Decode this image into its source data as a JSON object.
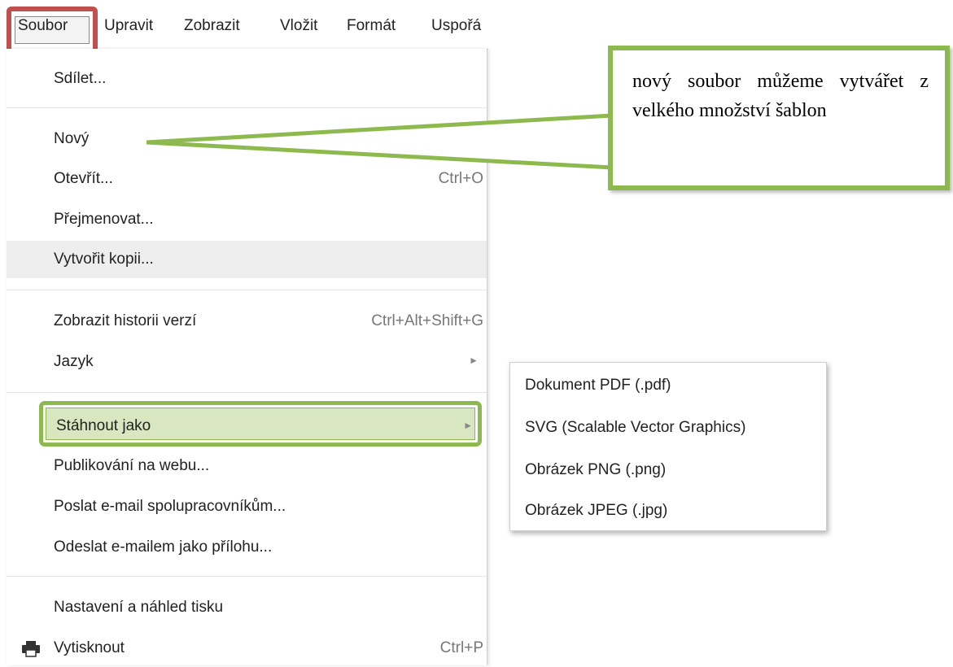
{
  "menubar": {
    "items": [
      "Soubor",
      "Upravit",
      "Zobrazit",
      "Vložit",
      "Formát",
      "Uspořá"
    ]
  },
  "menu": {
    "items": [
      {
        "label": "Sdílet...",
        "shortcut": ""
      },
      {
        "label": "Nový",
        "shortcut": ""
      },
      {
        "label": "Otevřít...",
        "shortcut": "Ctrl+O"
      },
      {
        "label": "Přejmenovat...",
        "shortcut": ""
      },
      {
        "label": "Vytvořit kopii...",
        "shortcut": ""
      },
      {
        "label": "Zobrazit historii verzí",
        "shortcut": "Ctrl+Alt+Shift+G"
      },
      {
        "label": "Jazyk",
        "shortcut": ""
      },
      {
        "label": "Stáhnout jako",
        "shortcut": ""
      },
      {
        "label": "Publikování na webu...",
        "shortcut": ""
      },
      {
        "label": "Poslat e-mail spolupracovníkům...",
        "shortcut": ""
      },
      {
        "label": "Odeslat e-mailem jako přílohu...",
        "shortcut": ""
      },
      {
        "label": "Nastavení a náhled tisku",
        "shortcut": ""
      },
      {
        "label": "Vytisknout",
        "shortcut": "Ctrl+P"
      }
    ],
    "submenu_arrow": "►",
    "print_icon": "printer-icon"
  },
  "submenu": {
    "items": [
      "Dokument PDF (.pdf)",
      "SVG (Scalable Vector Graphics)",
      "Obrázek PNG (.png)",
      "Obrázek JPEG (.jpg)"
    ]
  },
  "callout": {
    "text": "nový soubor můžeme vytvářet z velkého množství šablon"
  },
  "colors": {
    "highlight_red": "#c0504d",
    "highlight_green": "#8db94e",
    "highlight_fill": "#d8e7c0",
    "hover_row": "#eeeeee"
  }
}
